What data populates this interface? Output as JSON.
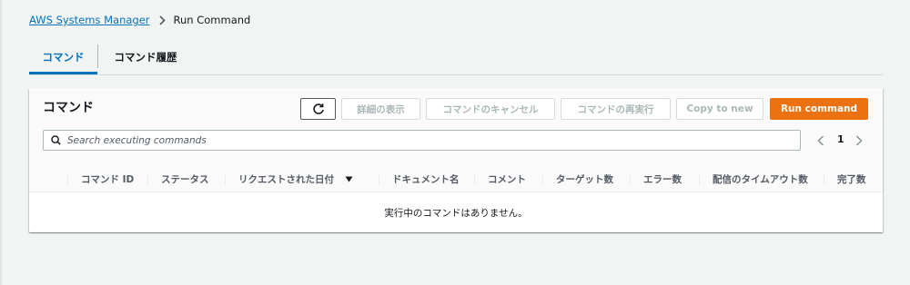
{
  "breadcrumb": {
    "items": [
      {
        "label": "AWS Systems Manager",
        "link": true
      },
      {
        "label": "Run Command",
        "link": false
      }
    ],
    "separator_icon": "chevron-right-icon"
  },
  "tabs": [
    {
      "label": "コマンド",
      "active": true
    },
    {
      "label": "コマンド履歴",
      "active": false
    }
  ],
  "panel": {
    "title": "コマンド",
    "buttons": {
      "refresh_icon": "refresh-icon",
      "details": "詳細の表示",
      "cancel": "コマンドのキャンセル",
      "rerun": "コマンドの再実行",
      "copy": "Copy to new",
      "run": "Run command"
    },
    "search": {
      "placeholder": "Search executing commands",
      "value": "",
      "icon": "search-icon"
    },
    "pagination": {
      "current_page": "1",
      "prev_icon": "chevron-left-icon",
      "next_icon": "chevron-right-icon"
    },
    "table": {
      "columns": [
        "コマンド ID",
        "ステータス",
        "リクエストされた日付",
        "ドキュメント名",
        "コメント",
        "ターゲット数",
        "エラー数",
        "配信のタイムアウト数",
        "完了数"
      ],
      "sorted_column": "リクエストされた日付",
      "sort_direction": "descending",
      "empty_message": "実行中のコマンドはありません。"
    }
  },
  "colors": {
    "accent": "#0073bb",
    "primary_button": "#ec7211",
    "background": "#f2f3f3",
    "disabled_text": "#aab7b8"
  }
}
